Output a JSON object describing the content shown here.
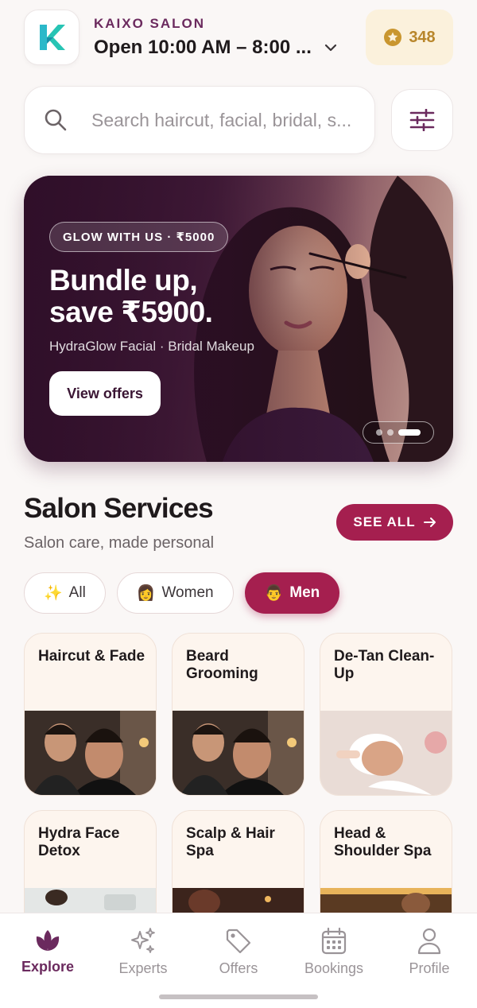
{
  "header": {
    "store_name": "KAIXO SALON",
    "hours": "Open 10:00 AM – 8:00 ...",
    "points": "348"
  },
  "search": {
    "placeholder": "Search haircut, facial, bridal, s..."
  },
  "banner": {
    "pill": "GLOW WITH US · ₹5000",
    "headline_line1": "Bundle up,",
    "headline_line2": "save ₹5900.",
    "subline": "HydraGlow Facial · Bridal Makeup",
    "cta": "View offers"
  },
  "section": {
    "title": "Salon Services",
    "subtitle": "Salon care, made personal",
    "see_all": "SEE ALL"
  },
  "chips": [
    {
      "emoji": "✨",
      "label": "All"
    },
    {
      "emoji": "👩",
      "label": "Women"
    },
    {
      "emoji": "👨",
      "label": "Men"
    }
  ],
  "services": [
    {
      "label": "Haircut & Fade"
    },
    {
      "label": "Beard Grooming"
    },
    {
      "label": "De-Tan Clean-Up"
    },
    {
      "label": "Hydra Face Detox"
    },
    {
      "label": "Scalp & Hair Spa"
    },
    {
      "label": "Head & Shoulder Spa"
    }
  ],
  "nav": [
    {
      "label": "Explore",
      "icon": "lotus-icon"
    },
    {
      "label": "Experts",
      "icon": "sparkles-icon"
    },
    {
      "label": "Offers",
      "icon": "tag-icon"
    },
    {
      "label": "Bookings",
      "icon": "calendar-icon"
    },
    {
      "label": "Profile",
      "icon": "person-icon"
    }
  ],
  "colors": {
    "accent": "#a51f4f",
    "brand": "#6b2a5e",
    "gold": "#b8862b"
  }
}
